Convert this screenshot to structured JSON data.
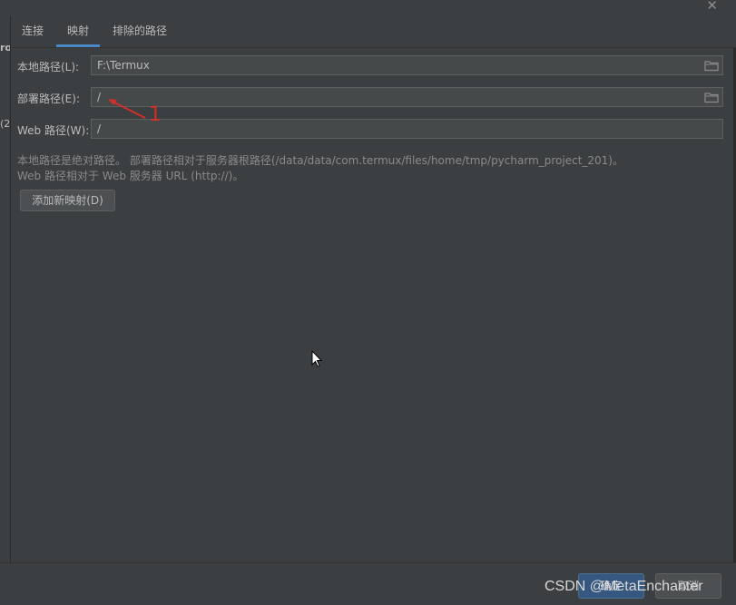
{
  "window": {
    "close_glyph": "✕"
  },
  "left_strip": {
    "top_text": "ro",
    "mid_text": "(2"
  },
  "tabs": [
    {
      "label": "连接",
      "active": false
    },
    {
      "label": "映射",
      "active": true
    },
    {
      "label": "排除的路径",
      "active": false
    }
  ],
  "form": {
    "local_path": {
      "label": "本地路径(L):",
      "value": "F:\\Termux",
      "icon": "folder-icon"
    },
    "deploy_path": {
      "label": "部署路径(E):",
      "value": "/",
      "icon": "folder-icon"
    },
    "web_path": {
      "label": "Web 路径(W):",
      "value": "/"
    }
  },
  "hints": {
    "line1": "本地路径是绝对路径。 部署路径相对于服务器根路径(/data/data/com.termux/files/home/tmp/pycharm_project_201)。",
    "line2": "Web 路径相对于 Web 服务器 URL (http://)。"
  },
  "add_mapping_label": "添加新映射(D)",
  "annotation": {
    "number": "1",
    "color": "#d0302a"
  },
  "footer": {
    "ok_label": "确定",
    "cancel_label": "取消"
  },
  "watermark": "CSDN @MetaEnchanter",
  "colors": {
    "accent": "#4a88c7",
    "background": "#3c3f41",
    "field": "#45494a"
  }
}
